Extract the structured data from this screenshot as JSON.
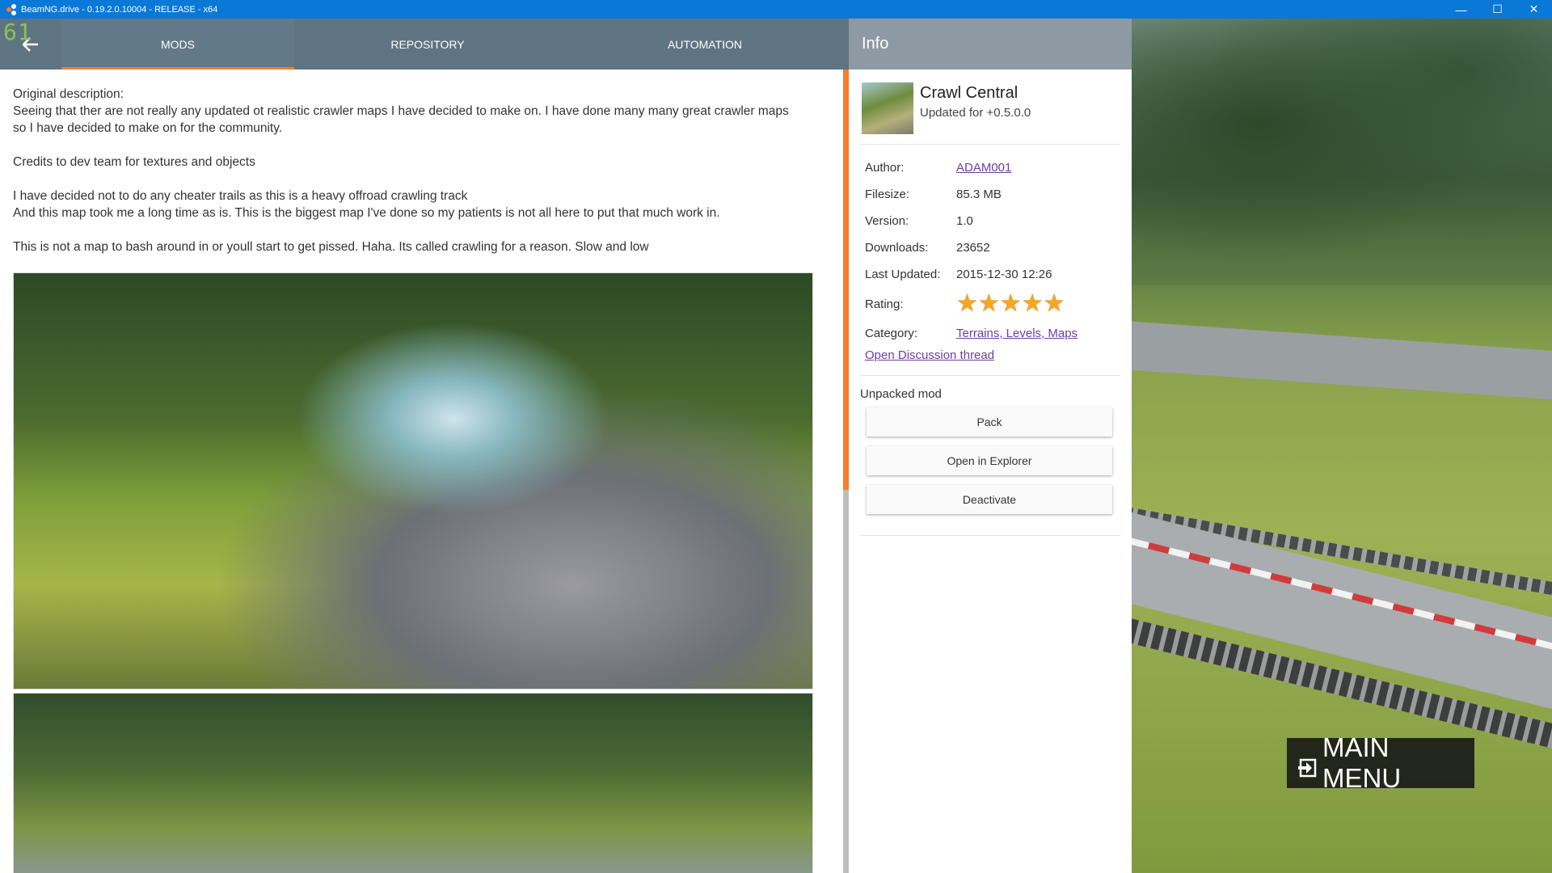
{
  "window": {
    "title": "BeamNG.drive - 0.19.2.0.10004 - RELEASE - x64",
    "minimize_glyph": "—",
    "maximize_glyph": "☐",
    "close_glyph": "✕",
    "app_icon": "beamng-logo-icon"
  },
  "fps": "61",
  "tabs": [
    {
      "label": "MODS",
      "active": true
    },
    {
      "label": "REPOSITORY",
      "active": false
    },
    {
      "label": "AUTOMATION",
      "active": false
    }
  ],
  "description": {
    "paragraphs": [
      [
        "Original description:",
        "Seeing that ther are not really any updated ot realistic crawler maps I have decided to make on. I have done many many great crawler maps",
        "so I have decided to make on for the community."
      ],
      [
        "Credits to dev team for textures and objects"
      ],
      [
        "I have decided not to do any cheater trails as this is a heavy offroad crawling track",
        "And this map took me a long time as is. This is the biggest map I've done so my patients is not all here to put that much work in."
      ],
      [
        "This is not a map to bash around in or youll start to get pissed. Haha. Its called crawling for a reason. Slow and low"
      ]
    ]
  },
  "info": {
    "header": "Info",
    "mod_title": "Crawl Central",
    "mod_subtitle": "Updated for +0.5.0.0",
    "author_label": "Author:",
    "author": "ADAM001",
    "filesize_label": "Filesize:",
    "filesize": "85.3 MB",
    "version_label": "Version:",
    "version": "1.0",
    "downloads_label": "Downloads:",
    "downloads": "23652",
    "last_updated_label": "Last Updated:",
    "last_updated": "2015-12-30 12:26",
    "rating_label": "Rating:",
    "rating": 5,
    "category_label": "Category:",
    "category": "Terrains, Levels, Maps",
    "discussion_link": "Open Discussion thread",
    "unpacked_label": "Unpacked mod",
    "buttons": {
      "pack": "Pack",
      "open_explorer": "Open in Explorer",
      "deactivate": "Deactivate"
    }
  },
  "main_menu": "MAIN MENU",
  "colors": {
    "accent": "#f57c2e",
    "topbar": "#5f7482",
    "titlebar": "#0a78d7",
    "star": "#f5a623",
    "link": "#6b3fa0"
  }
}
